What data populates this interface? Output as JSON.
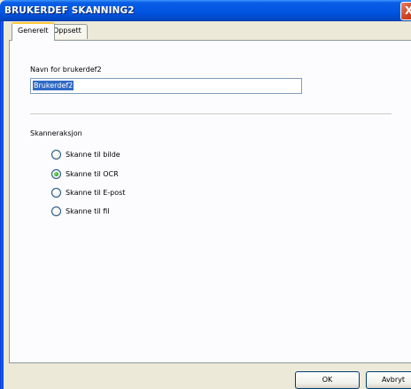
{
  "window": {
    "title": "BRUKERDEF SKANNING2"
  },
  "tabs": [
    {
      "label": "Generelt",
      "active": true
    },
    {
      "label": "Oppsett",
      "active": false
    }
  ],
  "name_field": {
    "label": "Navn for brukerdef2",
    "value": "Brukerdef2"
  },
  "scan_action": {
    "label": "Skanneraksjon",
    "options": [
      {
        "label": "Skanne til bilde",
        "selected": false
      },
      {
        "label": "Skanne til OCR",
        "selected": true
      },
      {
        "label": "Skanne til E-post",
        "selected": false
      },
      {
        "label": "Skanne til fil",
        "selected": false
      }
    ]
  },
  "buttons": {
    "ok": "OK",
    "cancel": "Avbryt",
    "close": "X"
  },
  "colors": {
    "title_bar": "#0054e3",
    "dialog_bg": "#ece9d8",
    "panel_bg": "#fcfcfe",
    "active_tab_highlight": "#ffc83c",
    "radio_selected": "#2ea61e"
  }
}
